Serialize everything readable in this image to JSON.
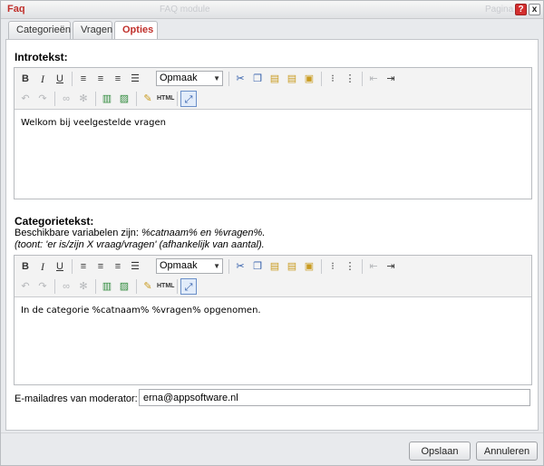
{
  "window": {
    "title": "Faq",
    "ghost_title": "FAQ module",
    "ghost_right": "Pagina",
    "help_label": "?",
    "close_label": "x"
  },
  "tabs": [
    {
      "label": "Categorieën"
    },
    {
      "label": "Vragen"
    },
    {
      "label": "Opties",
      "active": true
    }
  ],
  "toolbar": {
    "bold": "B",
    "italic": "I",
    "underline": "U",
    "format_select": "Opmaak",
    "html": "HTML",
    "icons": [
      "bold-icon",
      "italic-icon",
      "underline-icon",
      "align-left-icon",
      "align-center-icon",
      "align-right-icon",
      "align-justify-icon",
      "cut-icon",
      "copy-icon",
      "paste-icon",
      "paste-text-icon",
      "paste-word-icon",
      "bullet-list-icon",
      "numbered-list-icon",
      "outdent-icon",
      "indent-icon",
      "undo-icon",
      "redo-icon",
      "link-icon",
      "unlink-icon",
      "table-icon",
      "image-icon",
      "clean-icon",
      "html-icon",
      "fullscreen-icon"
    ]
  },
  "intro": {
    "heading": "Introtekst:",
    "content": "Welkom bij veelgestelde vragen"
  },
  "category": {
    "heading": "Categorietekst:",
    "vars_prefix": "Beschikbare variabelen zijn: ",
    "vars": "%catnaam% en %vragen%.",
    "hint": "(toont: 'er is/zijn X vraag/vragen' (afhankelijk van aantal).",
    "content": "In de categorie %catnaam% %vragen% opgenomen."
  },
  "moderator": {
    "label": "E-mailadres van moderator:",
    "value": "erna@appsoftware.nl"
  },
  "footer": {
    "save_label": "Opslaan",
    "cancel_label": "Annuleren"
  }
}
